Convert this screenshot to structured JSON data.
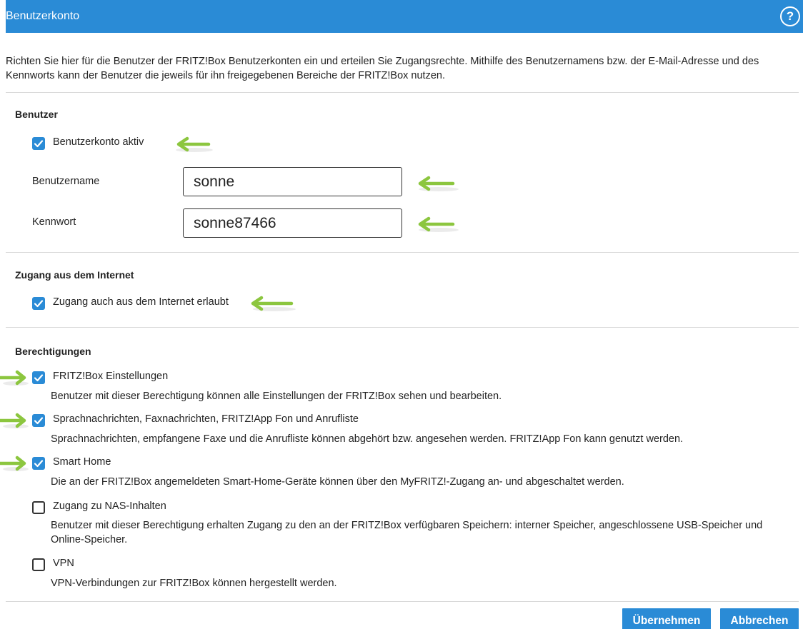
{
  "header": {
    "title": "Benutzerkonto",
    "help_label": "?"
  },
  "intro": "Richten Sie hier für die Benutzer der FRITZ!Box Benutzerkonten ein und erteilen Sie Zugangsrechte. Mithilfe des Benutzernamens bzw. der E-Mail-Adresse und des Kennworts kann der Benutzer die jeweils für ihn freigegebenen Bereiche der FRITZ!Box nutzen.",
  "benutzer": {
    "heading": "Benutzer",
    "account_active_label": "Benutzerkonto aktiv",
    "account_active_checked": true,
    "username_label": "Benutzername",
    "username_value": "sonne",
    "password_label": "Kennwort",
    "password_value": "sonne87466"
  },
  "internet": {
    "heading": "Zugang aus dem Internet",
    "access_label": "Zugang auch aus dem Internet erlaubt",
    "access_checked": true
  },
  "permissions": {
    "heading": "Berechtigungen",
    "items": [
      {
        "label": "FRITZ!Box Einstellungen",
        "checked": true,
        "description": "Benutzer mit dieser Berechtigung können alle Einstellungen der FRITZ!Box sehen und bearbeiten."
      },
      {
        "label": "Sprachnachrichten, Faxnachrichten, FRITZ!App Fon und Anrufliste",
        "checked": true,
        "description": "Sprachnachrichten, empfangene Faxe und die Anrufliste können abgehört bzw. angesehen werden. FRITZ!App Fon kann genutzt werden."
      },
      {
        "label": "Smart Home",
        "checked": true,
        "description": "Die an der FRITZ!Box angemeldeten Smart-Home-Geräte können über den MyFRITZ!-Zugang an- und abgeschaltet werden."
      },
      {
        "label": "Zugang zu NAS-Inhalten",
        "checked": false,
        "description": "Benutzer mit dieser Berechtigung erhalten Zugang zu den an der FRITZ!Box verfügbaren Speichern: interner Speicher, angeschlossene USB-Speicher und Online-Speicher."
      },
      {
        "label": "VPN",
        "checked": false,
        "description": "VPN-Verbindungen zur FRITZ!Box können hergestellt werden."
      }
    ]
  },
  "buttons": {
    "apply_label": "Übernehmen",
    "cancel_label": "Abbrechen"
  },
  "colors": {
    "accent": "#2a8bd6",
    "arrow": "#8cc63f"
  }
}
